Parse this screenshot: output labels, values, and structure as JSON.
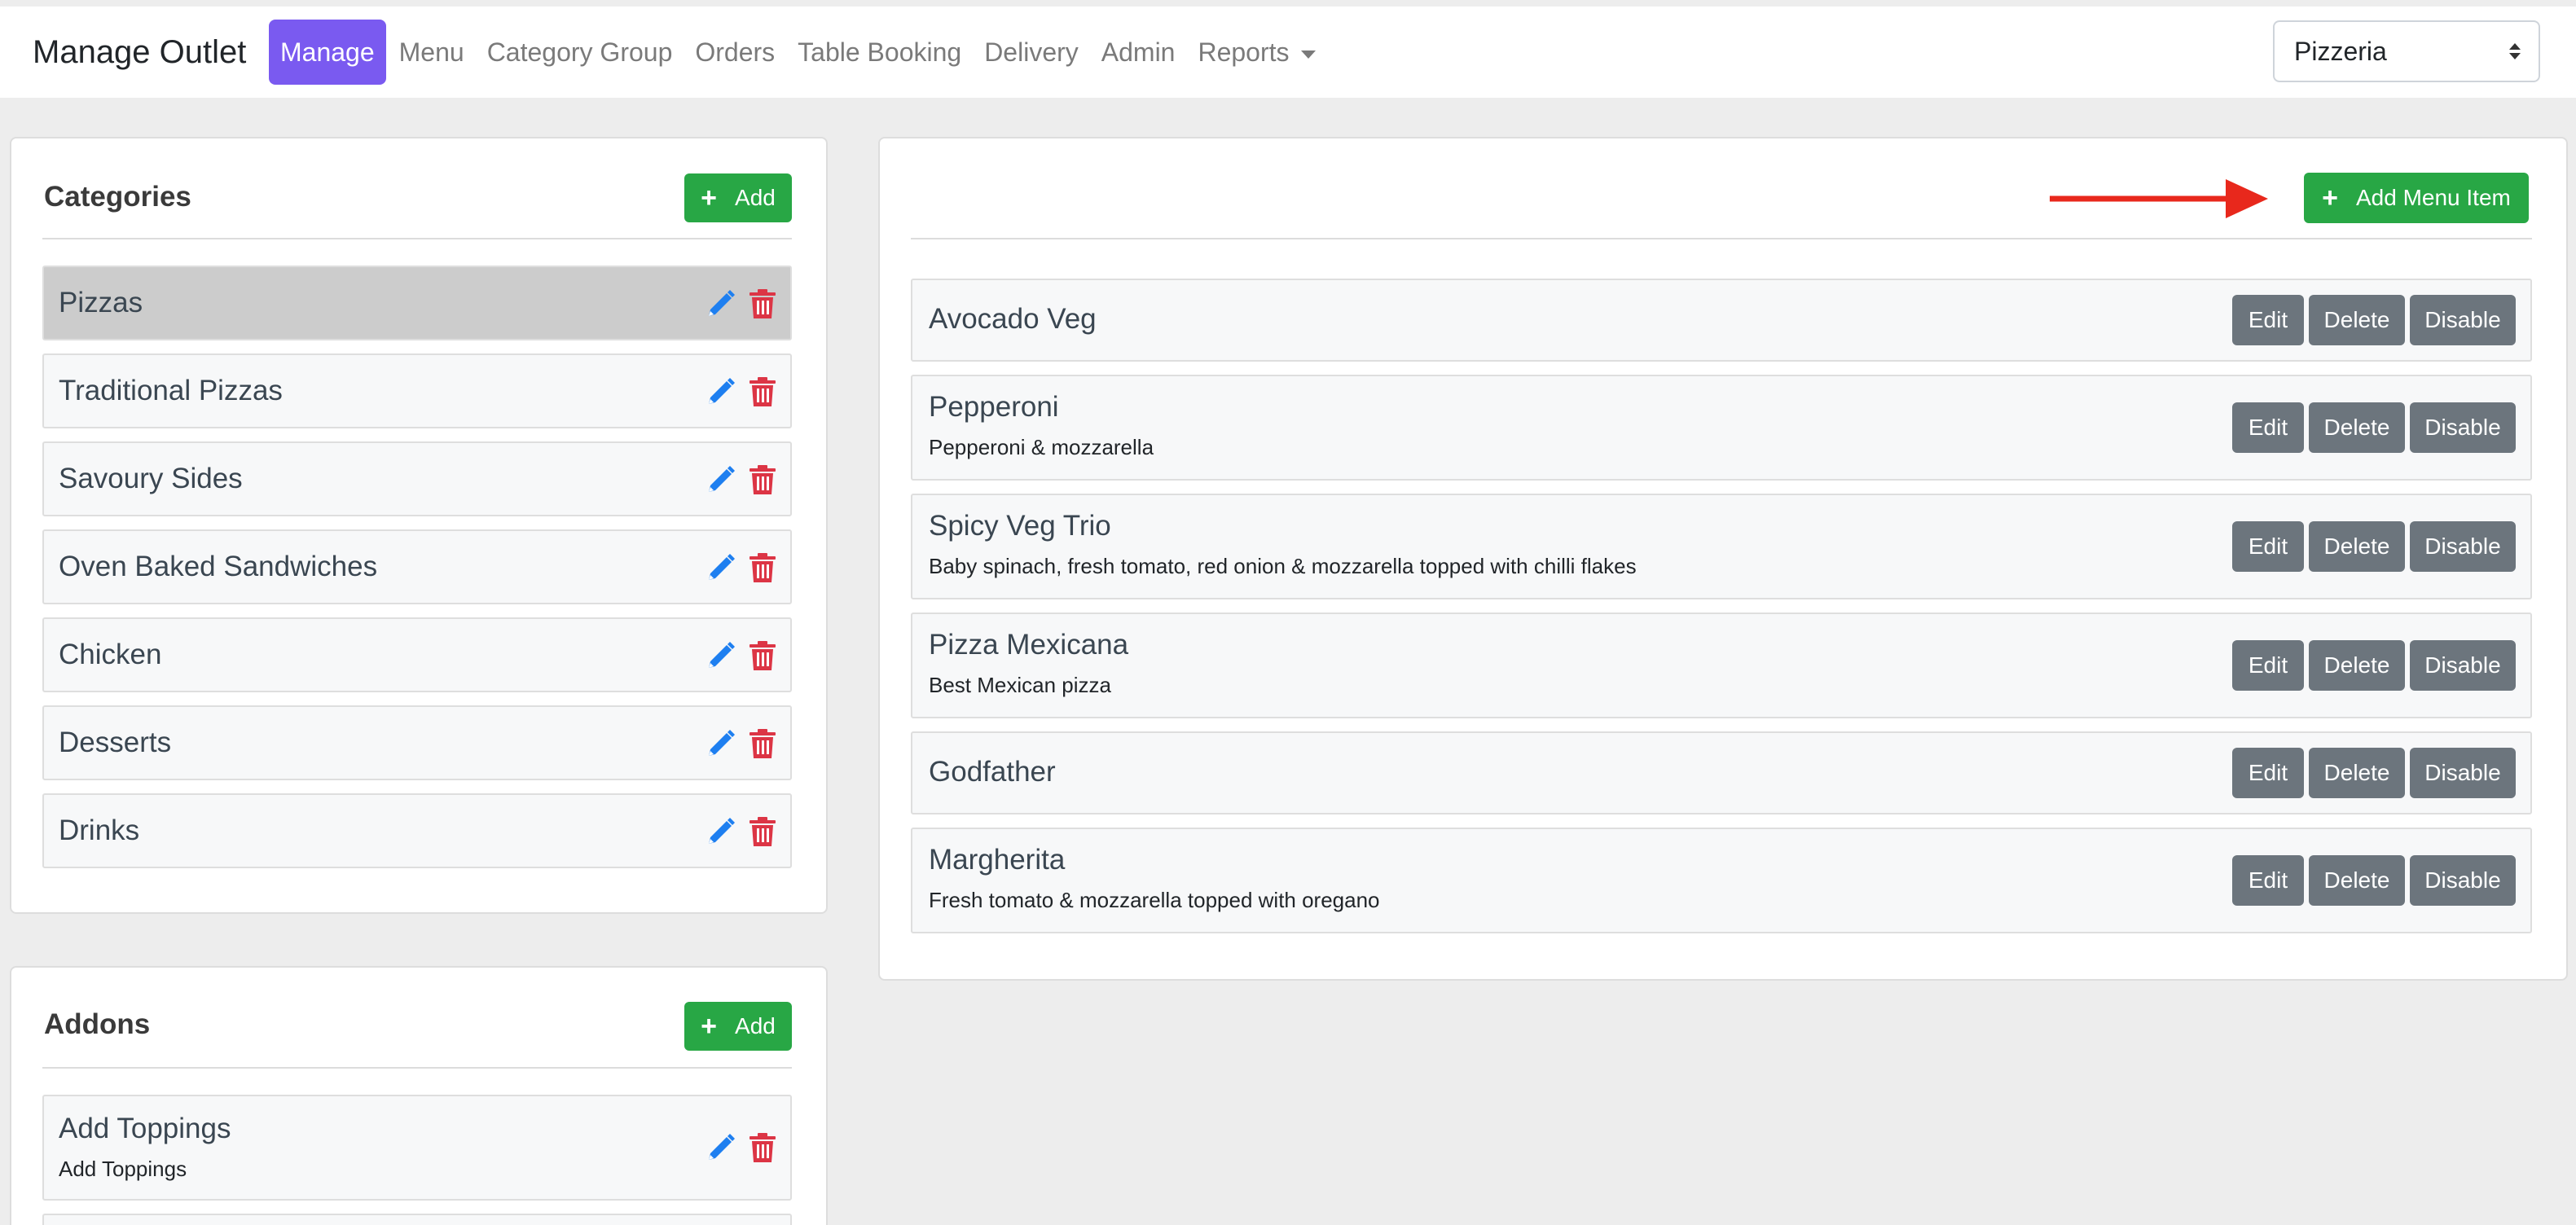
{
  "navbar": {
    "brand": "Manage Outlet",
    "items": [
      {
        "label": "Manage",
        "active": true
      },
      {
        "label": "Menu"
      },
      {
        "label": "Category Group"
      },
      {
        "label": "Orders"
      },
      {
        "label": "Table Booking"
      },
      {
        "label": "Delivery"
      },
      {
        "label": "Admin"
      },
      {
        "label": "Reports"
      }
    ],
    "outlet_select": "Pizzeria"
  },
  "categories": {
    "title": "Categories",
    "add_label": "Add",
    "items": [
      {
        "label": "Pizzas",
        "selected": true
      },
      {
        "label": "Traditional Pizzas"
      },
      {
        "label": "Savoury Sides"
      },
      {
        "label": "Oven Baked Sandwiches"
      },
      {
        "label": "Chicken"
      },
      {
        "label": "Desserts"
      },
      {
        "label": "Drinks"
      }
    ]
  },
  "addons": {
    "title": "Addons",
    "add_label": "Add",
    "items": [
      {
        "label": "Add Toppings",
        "description": "Add Toppings"
      }
    ]
  },
  "menu_items": {
    "add_label": "Add Menu Item",
    "actions": {
      "edit": "Edit",
      "delete": "Delete",
      "disable": "Disable"
    },
    "items": [
      {
        "title": "Avocado Veg",
        "description": ""
      },
      {
        "title": "Pepperoni",
        "description": "Pepperoni & mozzarella"
      },
      {
        "title": "Spicy Veg Trio",
        "description": "Baby spinach, fresh tomato, red onion & mozzarella topped with chilli flakes"
      },
      {
        "title": "Pizza Mexicana",
        "description": "Best Mexican pizza"
      },
      {
        "title": "Godfather",
        "description": ""
      },
      {
        "title": "Margherita",
        "description": "Fresh tomato & mozzarella topped with oregano"
      }
    ]
  },
  "colors": {
    "primary": "#7a5af0",
    "success": "#28a745",
    "secondary": "#6c757d",
    "edit_icon": "#1e7ff0",
    "delete_icon": "#dc3545",
    "annotation_arrow": "#e8281c"
  }
}
